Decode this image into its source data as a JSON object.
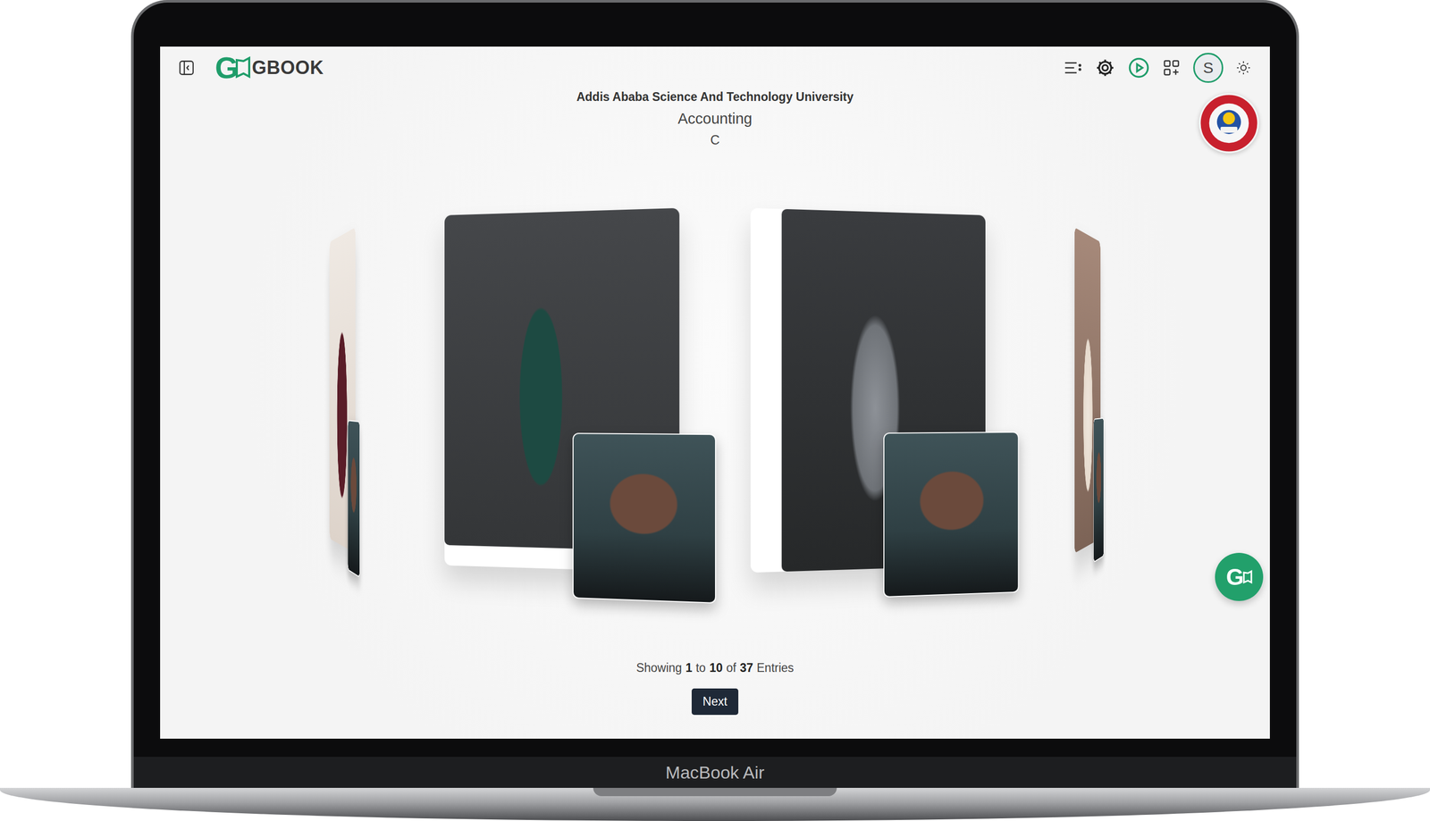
{
  "app": {
    "logo": {
      "mark": "G",
      "name": "GBOOK"
    }
  },
  "toolbar": {
    "avatar": "S"
  },
  "header": {
    "institution": "Addis Ababa Science And Technology University",
    "department": "Accounting",
    "section": "C"
  },
  "cards": [
    {
      "selected": false
    },
    {
      "selected": true
    },
    {
      "selected": true
    },
    {
      "selected": false
    }
  ],
  "pagination": {
    "prefix": "Showing",
    "from": "1",
    "to_word": "to",
    "to": "10",
    "of_word": "of",
    "total": "37",
    "suffix": "Entries",
    "next": "Next"
  },
  "device": {
    "label": "MacBook Air"
  }
}
